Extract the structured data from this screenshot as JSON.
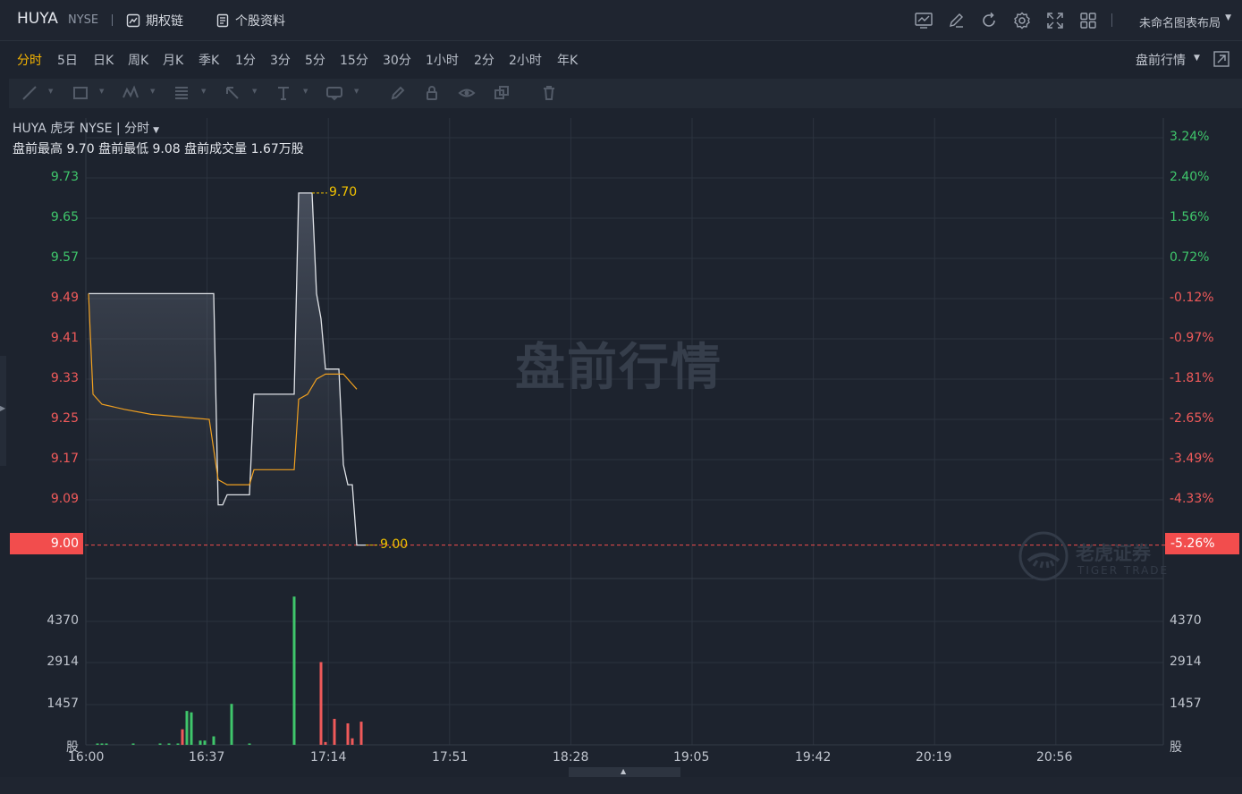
{
  "header": {
    "symbol": "HUYA",
    "exchange": "NYSE",
    "options_label": "期权链",
    "profile_label": "个股资料",
    "layout_label": "未命名图表布局",
    "tool_icons": [
      "chart-settings-icon",
      "edit-icon",
      "refresh-icon",
      "gear-icon",
      "fullscreen-icon",
      "grid-layout-icon"
    ]
  },
  "periods": {
    "items": [
      "分时",
      "5日",
      "日K",
      "周K",
      "月K",
      "季K",
      "1分",
      "3分",
      "5分",
      "15分",
      "30分",
      "1小时",
      "2分",
      "2小时",
      "年K"
    ],
    "active": "分时",
    "session_label": "盘前行情"
  },
  "drawing_tools": [
    "line-tool-icon",
    "rectangle-tool-icon",
    "pattern-tool-icon",
    "fib-tool-icon",
    "arrow-tool-icon",
    "text-tool-icon",
    "comment-tool-icon",
    "pen-icon",
    "lock-icon",
    "eye-icon",
    "copy-icon",
    "trash-icon"
  ],
  "chart": {
    "title_line": "HUYA 虎牙 NYSE | 分时",
    "stats_line": "盘前最高 9.70 盘前最低 9.08 盘前成交量 1.67万股",
    "watermark": "盘前行情",
    "logo_cn": "老虎证券",
    "logo_en": "TIGER TRADE",
    "high_label": "9.70",
    "low_label": "9.00",
    "current_price": "9.00",
    "current_pct": "-5.26%",
    "vol_unit": "股"
  },
  "chart_data": {
    "type": "line",
    "session": "pre-market",
    "x_ticks": [
      "16:00",
      "16:37",
      "17:14",
      "17:51",
      "18:28",
      "19:05",
      "19:42",
      "20:19",
      "20:56"
    ],
    "y_ticks_price": [
      "9.73",
      "9.65",
      "9.57",
      "9.49",
      "9.41",
      "9.33",
      "9.25",
      "9.17",
      "9.09"
    ],
    "y_ticks_pct": [
      "3.24%",
      "2.40%",
      "1.56%",
      "0.72%",
      "-0.12%",
      "-0.97%",
      "-1.81%",
      "-2.65%",
      "-3.49%",
      "-4.33%"
    ],
    "y_ticks_volume": [
      "4370",
      "2914",
      "1457"
    ],
    "ylim_price": [
      9.0,
      9.73
    ],
    "reference_price": 9.5,
    "series": [
      {
        "type": "price",
        "points": [
          [
            0,
            9.5
          ],
          [
            28,
            9.5
          ],
          [
            29,
            9.08
          ],
          [
            30,
            9.08
          ],
          [
            31,
            9.1
          ],
          [
            36,
            9.1
          ],
          [
            37,
            9.3
          ],
          [
            46,
            9.3
          ],
          [
            47,
            9.7
          ],
          [
            50,
            9.7
          ],
          [
            51,
            9.5
          ],
          [
            52,
            9.45
          ],
          [
            53,
            9.35
          ],
          [
            56,
            9.35
          ],
          [
            57,
            9.16
          ],
          [
            58,
            9.12
          ],
          [
            59,
            9.12
          ],
          [
            60,
            9.0
          ],
          [
            61,
            9.0
          ],
          [
            62,
            9.0
          ]
        ]
      },
      {
        "type": "average",
        "points": [
          [
            0,
            9.5
          ],
          [
            1,
            9.3
          ],
          [
            3,
            9.28
          ],
          [
            8,
            9.27
          ],
          [
            14,
            9.26
          ],
          [
            27,
            9.25
          ],
          [
            29,
            9.13
          ],
          [
            31,
            9.12
          ],
          [
            36,
            9.12
          ],
          [
            37,
            9.15
          ],
          [
            46,
            9.15
          ],
          [
            47,
            9.29
          ],
          [
            49,
            9.3
          ],
          [
            51,
            9.33
          ],
          [
            53,
            9.34
          ],
          [
            57,
            9.34
          ],
          [
            58,
            9.33
          ],
          [
            59,
            9.32
          ],
          [
            60,
            9.31
          ]
        ]
      }
    ],
    "volumes": [
      {
        "t": 2,
        "v": 44,
        "dir": "up"
      },
      {
        "t": 3,
        "v": 44,
        "dir": "up"
      },
      {
        "t": 4,
        "v": 30,
        "dir": "up"
      },
      {
        "t": 10,
        "v": 30,
        "dir": "up"
      },
      {
        "t": 16,
        "v": 30,
        "dir": "up"
      },
      {
        "t": 18,
        "v": 44,
        "dir": "up"
      },
      {
        "t": 20,
        "v": 44,
        "dir": "up"
      },
      {
        "t": 21,
        "v": 550,
        "dir": "down"
      },
      {
        "t": 22,
        "v": 1200,
        "dir": "up"
      },
      {
        "t": 23,
        "v": 1150,
        "dir": "up"
      },
      {
        "t": 25,
        "v": 150,
        "dir": "up"
      },
      {
        "t": 26,
        "v": 150,
        "dir": "up"
      },
      {
        "t": 28,
        "v": 300,
        "dir": "up"
      },
      {
        "t": 32,
        "v": 1450,
        "dir": "up"
      },
      {
        "t": 36,
        "v": 20,
        "dir": "up"
      },
      {
        "t": 46,
        "v": 5250,
        "dir": "up"
      },
      {
        "t": 52,
        "v": 2930,
        "dir": "down"
      },
      {
        "t": 53,
        "v": 100,
        "dir": "down"
      },
      {
        "t": 55,
        "v": 920,
        "dir": "down"
      },
      {
        "t": 58,
        "v": 760,
        "dir": "down"
      },
      {
        "t": 59,
        "v": 230,
        "dir": "down"
      },
      {
        "t": 61,
        "v": 820,
        "dir": "down"
      }
    ],
    "colors": {
      "up": "#3fc66b",
      "down": "#f05a5a",
      "price_line": "#e0e3e8",
      "avg_line": "#f0a020"
    },
    "grid": true
  }
}
